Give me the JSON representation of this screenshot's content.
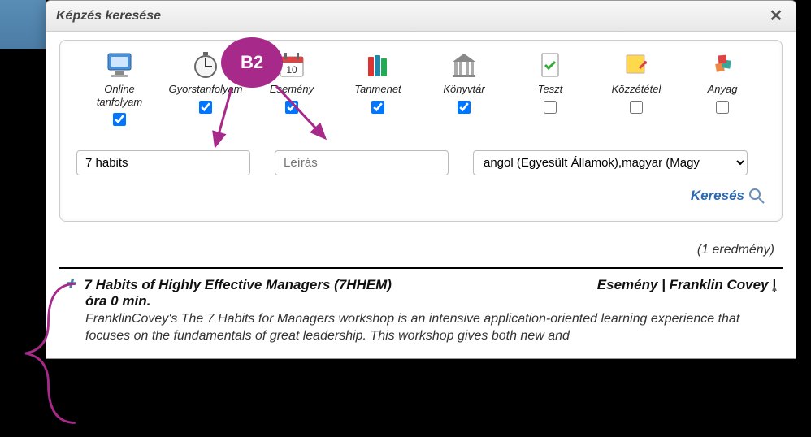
{
  "dialog": {
    "title": "Képzés keresése"
  },
  "types": [
    {
      "name": "online-tanfolyam",
      "label": "Online\ntanfolyam",
      "checked": true
    },
    {
      "name": "gyorstanfolyam",
      "label": "Gyorstanfolyam",
      "checked": true
    },
    {
      "name": "esemeny",
      "label": "Esemény",
      "checked": true
    },
    {
      "name": "tanmenet",
      "label": "Tanmenet",
      "checked": true
    },
    {
      "name": "konyvtar",
      "label": "Könyvtár",
      "checked": true
    },
    {
      "name": "teszt",
      "label": "Teszt",
      "checked": false
    },
    {
      "name": "kozzetetel",
      "label": "Közzététel",
      "checked": false
    },
    {
      "name": "anyag",
      "label": "Anyag",
      "checked": false
    }
  ],
  "search": {
    "value": "7 habits",
    "desc_placeholder": "Leírás",
    "language": "angol (Egyesült Államok),magyar (Magy",
    "button": "Keresés"
  },
  "results": {
    "count_text": "(1 eredmény)",
    "item": {
      "title": "7 Habits of Highly Effective Managers (7HHEM)",
      "meta": "Esemény | Franklin Covey |",
      "duration": "óra 0 min.",
      "desc": "FranklinCovey's The 7 Habits for Managers workshop is an intensive application-oriented learning experience that focuses on the fundamentals of great leadership. This workshop gives both new and"
    }
  },
  "annotation": {
    "label": "B2"
  }
}
